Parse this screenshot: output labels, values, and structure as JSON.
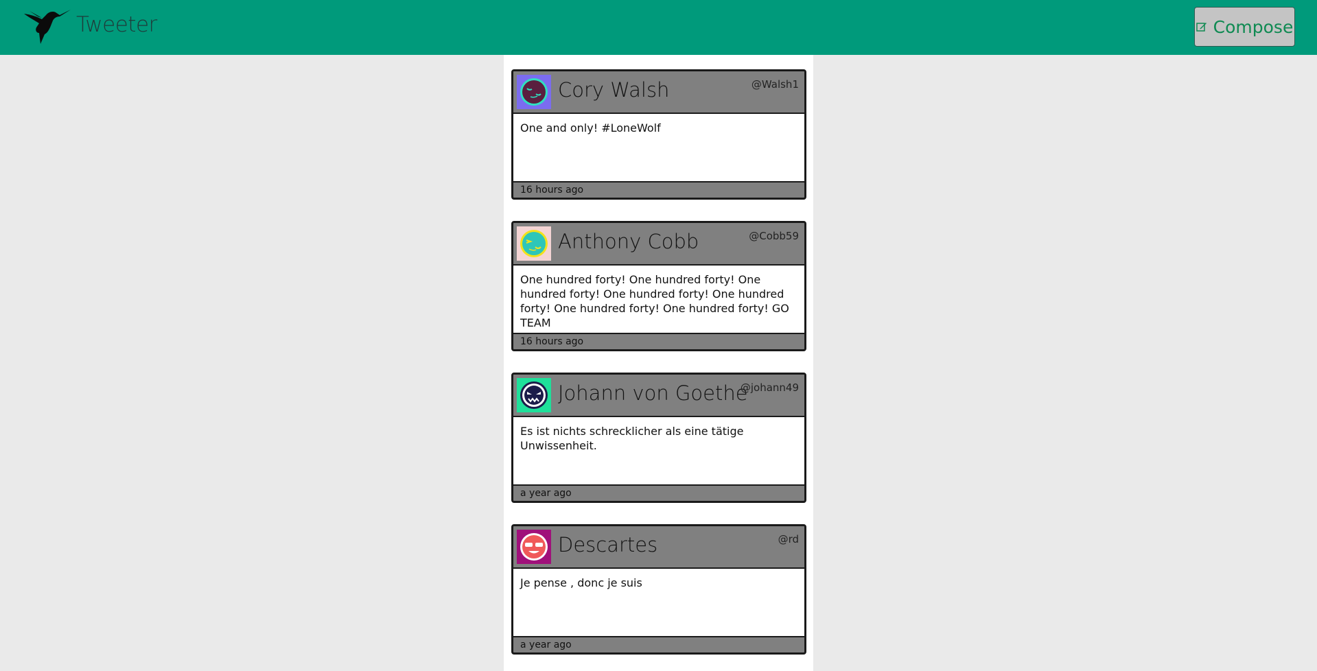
{
  "navbar": {
    "brand": "Tweeter",
    "compose_label": "Compose",
    "background_color": "#009a7b",
    "logo_icon": "hummingbird-icon",
    "compose_icon": "edit-icon"
  },
  "tweets": [
    {
      "name": "Cory Walsh",
      "handle": "@Walsh1",
      "text": "One and only! #LoneWolf",
      "time": "16 hours ago",
      "avatar_bg": "#7b6cf0",
      "avatar_face": "#5a1f3f",
      "avatar_ring": "#2fe0c0"
    },
    {
      "name": "Anthony Cobb",
      "handle": "@Cobb59",
      "text": "One hundred forty! One hundred forty! One hundred forty! One hundred forty! One hundred forty! One hundred forty! One hundred forty! GO TEAM",
      "time": "16 hours ago",
      "avatar_bg": "#f4d4d4",
      "avatar_face": "#2ec6b8",
      "avatar_ring": "#f2e21a"
    },
    {
      "name": "Johann von Goethe",
      "handle": "@johann49",
      "text": "Es ist nichts schrecklicher als eine tätige Unwissenheit.",
      "time": "a year ago",
      "avatar_bg": "#1fe09a",
      "avatar_face": "#1c1c4a",
      "avatar_ring": "#ffffff"
    },
    {
      "name": "Descartes",
      "handle": "@rd",
      "text": "Je pense , donc je suis",
      "time": "a year ago",
      "avatar_bg": "#a0107a",
      "avatar_face": "#f05a5a",
      "avatar_ring": "#ffffff"
    }
  ]
}
